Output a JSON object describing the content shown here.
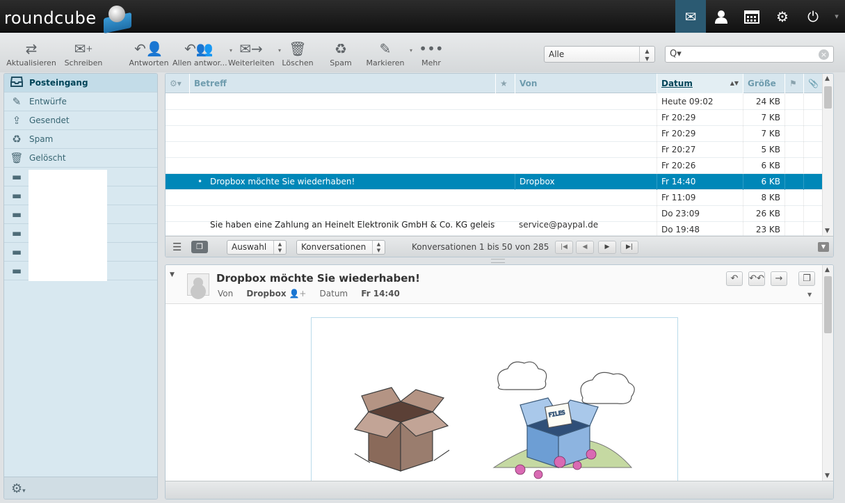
{
  "app": {
    "logo_text": "roundcube"
  },
  "taskbar": [
    {
      "name": "mail-task-icon",
      "glyph": "✉",
      "active": true
    },
    {
      "name": "contacts-task-icon",
      "glyph": "👤",
      "active": false
    },
    {
      "name": "calendar-task-icon",
      "glyph": "▦",
      "active": false
    },
    {
      "name": "settings-task-icon",
      "glyph": "⚙",
      "active": false
    },
    {
      "name": "logout-task-icon",
      "glyph": "⏻",
      "active": false
    }
  ],
  "toolbar": {
    "refresh": "Aktualisieren",
    "compose": "Schreiben",
    "reply": "Antworten",
    "reply_all": "Allen antwor...",
    "forward": "Weiterleiten",
    "delete": "Löschen",
    "spam": "Spam",
    "mark": "Markieren",
    "more": "Mehr"
  },
  "filter": {
    "value": "Alle"
  },
  "search": {
    "icon": "Q▾"
  },
  "folders": [
    {
      "label": "Posteingang",
      "icon": "inbox-icon",
      "glyph": "⬓"
    },
    {
      "label": "Entwürfe",
      "icon": "drafts-icon",
      "glyph": "✎"
    },
    {
      "label": "Gesendet",
      "icon": "sent-icon",
      "glyph": "⇪"
    },
    {
      "label": "Spam",
      "icon": "spam-icon",
      "glyph": "♻"
    },
    {
      "label": "Gelöscht",
      "icon": "trash-icon",
      "glyph": "🗑"
    }
  ],
  "list": {
    "headers": {
      "subject": "Betreff",
      "from": "Von",
      "date": "Datum",
      "size": "Größe"
    },
    "rows": [
      {
        "subject": "",
        "from": "",
        "date": "Heute 09:02",
        "size": "24 KB"
      },
      {
        "subject": "",
        "from": "",
        "date": "Fr 20:29",
        "size": "7 KB"
      },
      {
        "subject": "",
        "from": "",
        "date": "Fr 20:29",
        "size": "7 KB"
      },
      {
        "subject": "",
        "from": "",
        "date": "Fr 20:27",
        "size": "5 KB"
      },
      {
        "subject": "",
        "from": "",
        "date": "Fr 20:26",
        "size": "6 KB"
      },
      {
        "subject": "Dropbox möchte Sie wiederhaben!",
        "from": "Dropbox",
        "date": "Fr 14:40",
        "size": "6 KB"
      },
      {
        "subject": "",
        "from": "",
        "date": "Fr 11:09",
        "size": "8 KB"
      },
      {
        "subject": "",
        "from": "",
        "date": "Do 23:09",
        "size": "26 KB"
      },
      {
        "subject": "Sie haben eine Zahlung an Heinelt Elektronik GmbH & Co. KG geleistet",
        "from": "service@paypal.de",
        "date": "Do 19:48",
        "size": "23 KB"
      }
    ],
    "footer": {
      "select": "Auswahl",
      "threads": "Konversationen",
      "count": "Konversationen 1 bis 50 von 285"
    }
  },
  "preview": {
    "subject": "Dropbox möchte Sie wiederhaben!",
    "from_label": "Von",
    "from": "Dropbox",
    "date_label": "Datum",
    "date": "Fr 14:40"
  }
}
